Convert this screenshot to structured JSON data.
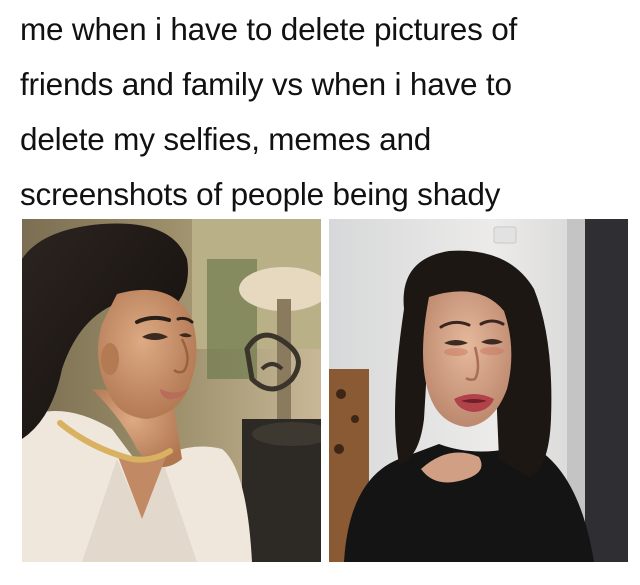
{
  "caption": {
    "lines": [
      "me when i have to delete pictures of",
      "friends and family vs when i have to",
      "delete my selfies, memes and",
      "screenshots of people being shady"
    ]
  },
  "panels": [
    {
      "id": "left",
      "depicts": "smiling woman with sleek dark hair, gold choker, white blazer"
    },
    {
      "id": "right",
      "depicts": "crying woman with long dark hair, black top"
    }
  ],
  "colors": {
    "text": "#111111",
    "background": "#ffffff",
    "skin": "#c8946c",
    "hair": "#1c1713",
    "blazer": "#f0e7de",
    "lips": "#b86d5b",
    "crying_lips": "#b2424a"
  }
}
